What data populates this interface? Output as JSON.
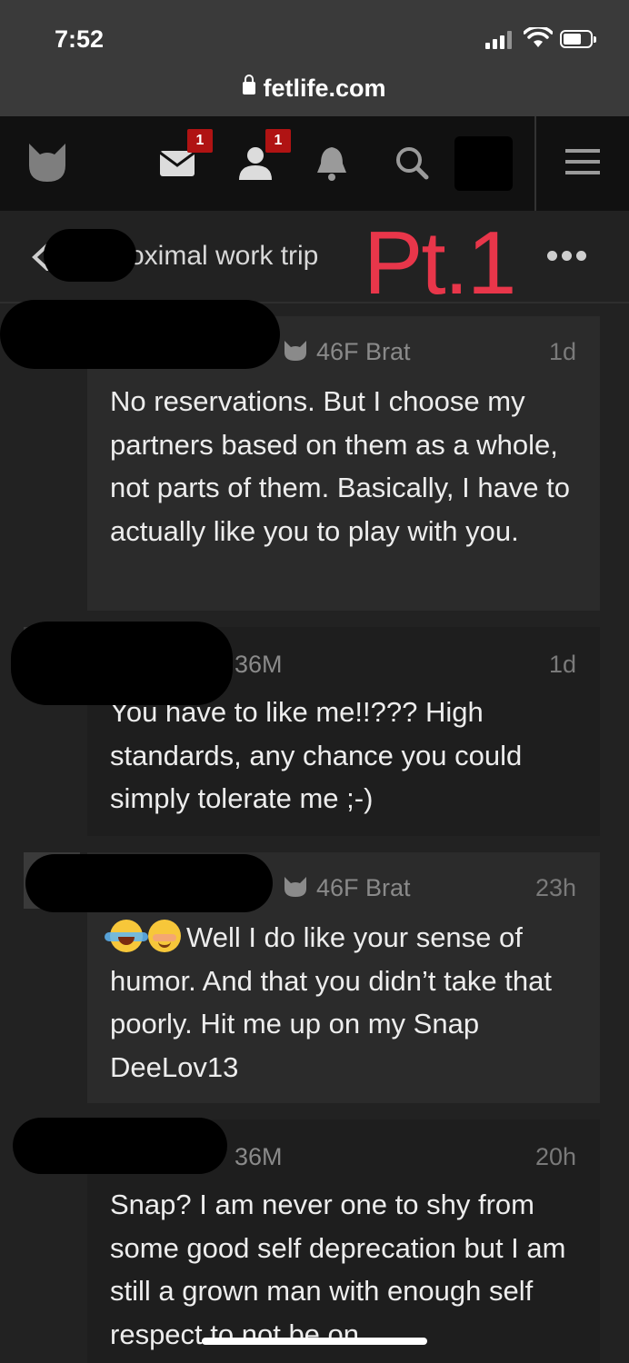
{
  "status_bar": {
    "time": "7:52"
  },
  "browser": {
    "url": "fetlife.com"
  },
  "nav": {
    "messages_badge": "1",
    "friends_badge": "1",
    "icons": [
      "fetlife-logo-icon",
      "mail-icon",
      "person-icon",
      "bell-icon",
      "search-icon",
      "hamburger-menu-icon"
    ]
  },
  "thread": {
    "title": "roximal work trip",
    "overlay_label": "Pt.1"
  },
  "comments": [
    {
      "meta": "46F Brat",
      "time_ago": "1d",
      "body": "No reservations. But I choose my partners based on them as a whole, not parts of them. Basically, I have to actually like you to play with you."
    },
    {
      "meta": "36M",
      "time_ago": "1d",
      "body": "You have to like me!!??? High standards, any chance you could simply tolerate me ;-)"
    },
    {
      "meta": "46F Brat",
      "time_ago": "23h",
      "body": "Well I do like your sense of humor. And that you didn’t take that poorly. Hit me up on my Snap DeeLov13"
    },
    {
      "meta": "36M",
      "time_ago": "20h",
      "body": "Snap? I am never one to shy from some good self deprecation but I am still a grown man with enough self respect to not be on"
    }
  ]
}
